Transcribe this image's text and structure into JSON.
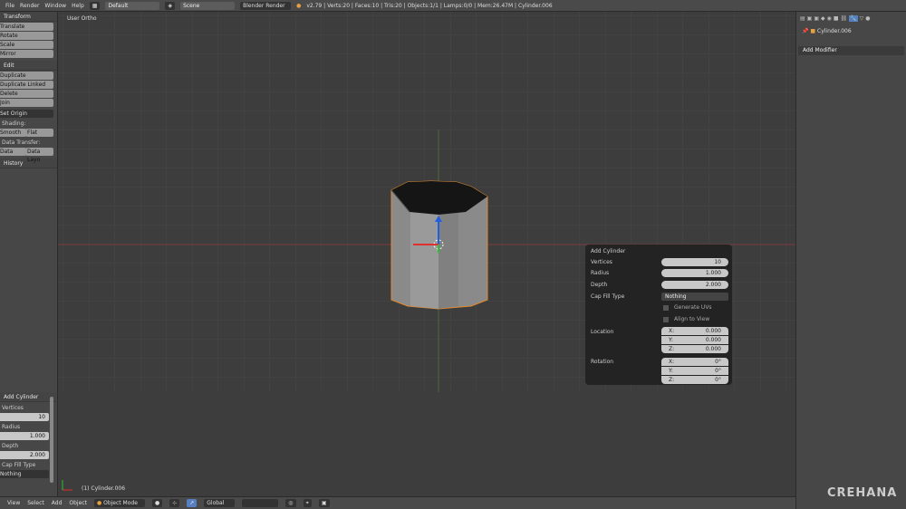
{
  "topbar": {
    "menus": [
      "File",
      "Render",
      "Window",
      "Help"
    ],
    "layout": "Default",
    "scene": "Scene",
    "engine": "Blender Render",
    "info": "v2.79 | Verts:20 | Faces:10 | Tris:20 | Objects:1/1 | Lamps:0/0 | Mem:26.47M | Cylinder.006"
  },
  "left": {
    "transform_title": "Transform",
    "transform": [
      "Translate",
      "Rotate",
      "Scale",
      "Mirror"
    ],
    "edit_title": "Edit",
    "edit": [
      "Duplicate",
      "Duplicate Linked",
      "Delete",
      "Join"
    ],
    "set_origin": "Set Origin",
    "shading_label": "Shading:",
    "smooth": "Smooth",
    "flat": "Flat",
    "data_transfer_label": "Data Transfer:",
    "data": "Data",
    "data_layout": "Data Layo",
    "history_title": "History",
    "op_title": "Add Cylinder",
    "op_vertices_label": "Vertices",
    "op_vertices": "10",
    "op_radius_label": "Radius",
    "op_radius": "1.000",
    "op_depth_label": "Depth",
    "op_depth": "2.000",
    "op_cap_label": "Cap Fill Type",
    "op_cap": "Nothing"
  },
  "viewport": {
    "view_label": "User Ortho",
    "object_label": "(1) Cylinder.006",
    "watermark": "CREHANA"
  },
  "operator": {
    "title": "Add Cylinder",
    "vertices_label": "Vertices",
    "vertices": "10",
    "radius_label": "Radius",
    "radius": "1.000",
    "depth_label": "Depth",
    "depth": "2.000",
    "cap_label": "Cap Fill Type",
    "cap": "Nothing",
    "gen_uvs": "Generate UVs",
    "align_view": "Align to View",
    "location_label": "Location",
    "loc_x": "0.000",
    "loc_y": "0.000",
    "loc_z": "0.000",
    "rotation_label": "Rotation",
    "rot_x": "0°",
    "rot_y": "0°",
    "rot_z": "0°",
    "x": "X:",
    "y": "Y:",
    "z": "Z:"
  },
  "right": {
    "object": "Cylinder.006",
    "add_modifier": "Add Modifier"
  },
  "bottombar": {
    "menus": [
      "View",
      "Select",
      "Add",
      "Object"
    ],
    "mode": "Object Mode",
    "orientation": "Global"
  }
}
